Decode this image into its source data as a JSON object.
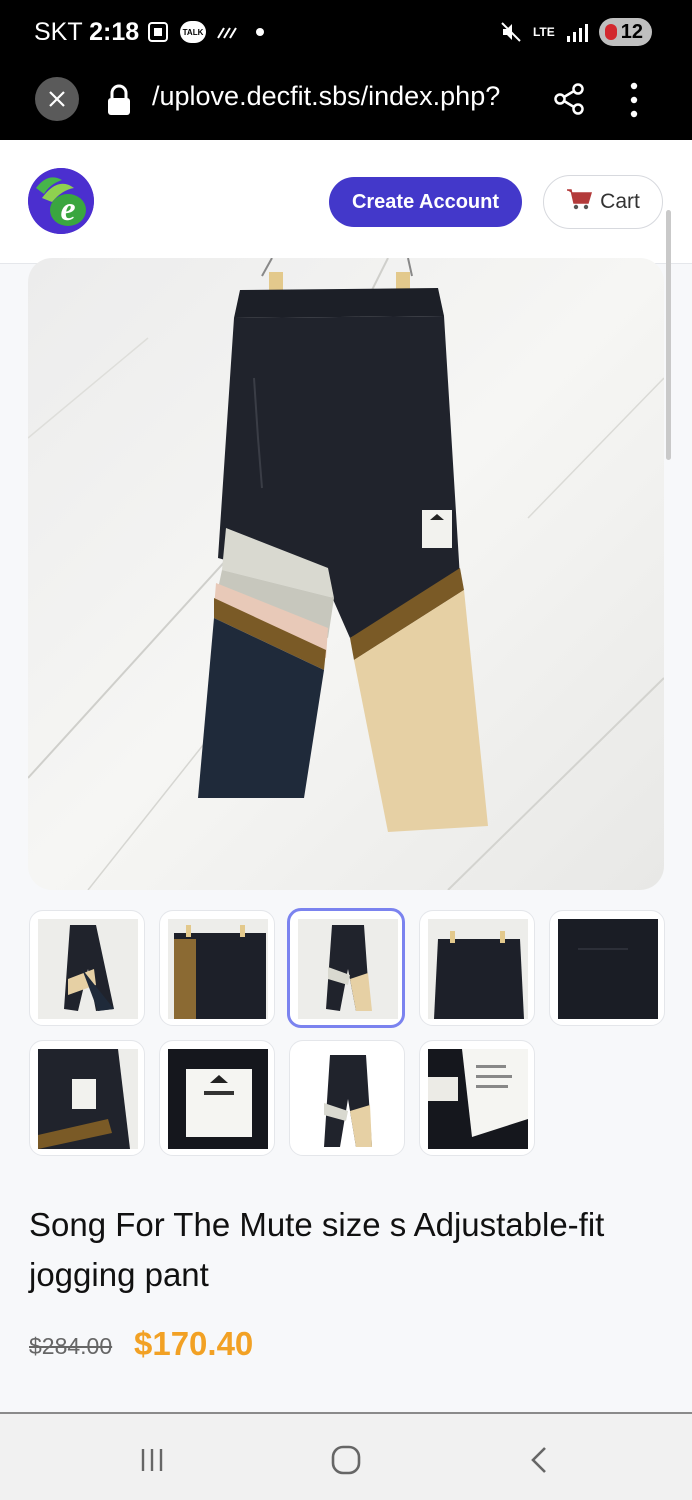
{
  "status_bar": {
    "carrier": "SKT",
    "time": "2:18",
    "talk_label": "TALK",
    "network": "LTE",
    "battery": "12"
  },
  "browser": {
    "url": "/uplove.decfit.sbs/index.php?",
    "icons": [
      "close-icon",
      "lock-icon",
      "share-icon",
      "more-vert-icon"
    ]
  },
  "header": {
    "logo_letter": "e",
    "create_account": "Create Account",
    "cart": "Cart",
    "cart_icon": "cart-icon"
  },
  "gallery": {
    "selected_index": 2,
    "thumb_count": 9
  },
  "product": {
    "title": "Song For The Mute size s Adjustable-fit jogging pant",
    "old_price": "$284.00",
    "price": "$170.40",
    "price_color": "#f2a124"
  },
  "colors": {
    "accent": "#4338ca",
    "price": "#f2a124"
  }
}
